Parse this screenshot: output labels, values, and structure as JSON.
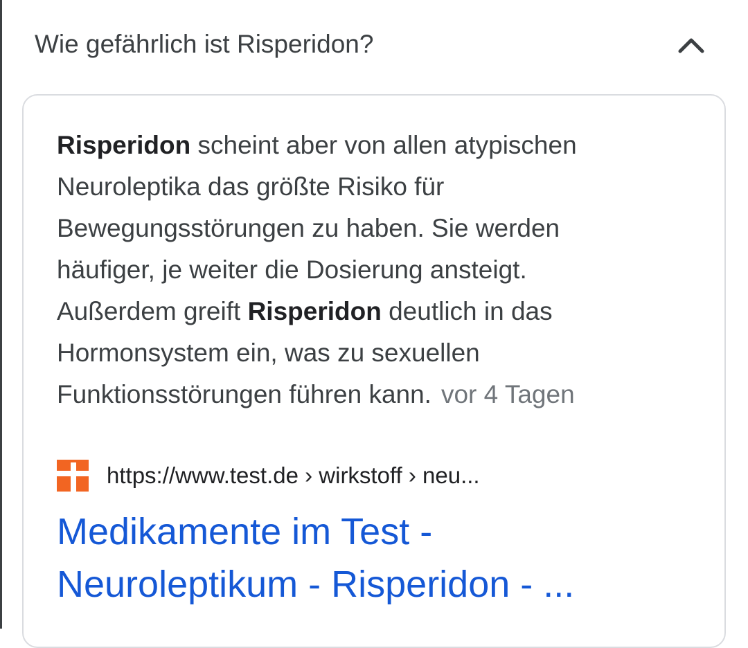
{
  "question": {
    "text": "Wie gefährlich ist Risperidon?",
    "expanded_icon": "chevron-up-icon"
  },
  "snippet": {
    "lines": [
      [
        {
          "text": "Risperidon",
          "bold": true
        },
        {
          "text": " scheint aber von allen atypischen",
          "bold": false
        }
      ],
      [
        {
          "text": "Neuroleptika das größte Risiko für",
          "bold": false
        }
      ],
      [
        {
          "text": "Bewegungsstörungen zu haben. Sie werden",
          "bold": false
        }
      ],
      [
        {
          "text": "häufiger, je weiter die Dosierung ansteigt.",
          "bold": false
        }
      ],
      [
        {
          "text": "Außerdem greift ",
          "bold": false
        },
        {
          "text": "Risperidon",
          "bold": true
        },
        {
          "text": " deutlich in das",
          "bold": false
        }
      ],
      [
        {
          "text": "Hormonsystem ein, was zu sexuellen",
          "bold": false
        }
      ],
      [
        {
          "text": "Funktionsstörungen führen kann.",
          "bold": false
        }
      ]
    ],
    "date": "vor 4 Tagen"
  },
  "source": {
    "favicon": "test-de-plus-icon",
    "url": "https://www.test.de › wirkstoff › neu..."
  },
  "result": {
    "title_lines": [
      "Medikamente im Test -",
      "Neuroleptikum - Risperidon - ..."
    ]
  },
  "colors": {
    "text": "#3c4043",
    "date": "#70757a",
    "link": "#1558d6",
    "card_border": "#dadce0",
    "favicon": "#f26522"
  }
}
